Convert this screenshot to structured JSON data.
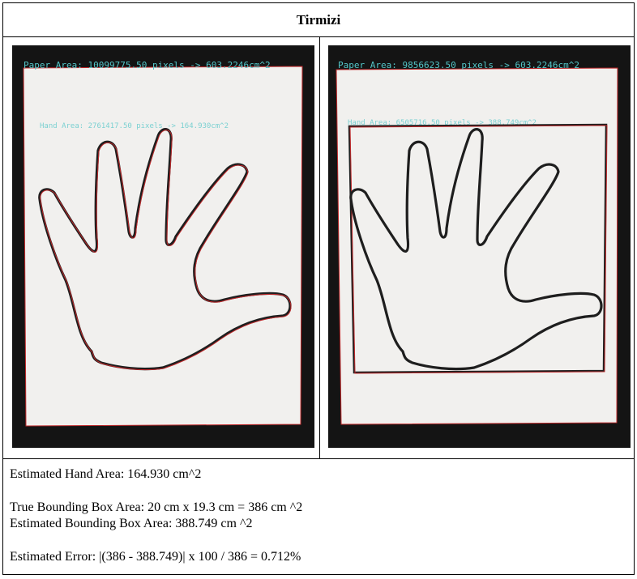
{
  "header": {
    "title": "Tirmizi"
  },
  "left_image": {
    "paper_area_label": "Paper Area: 10099775.50 pixels -> 603.2246cm^2",
    "hand_area_label": "Hand Area: 2761417.50 pixels -> 164.930cm^2"
  },
  "right_image": {
    "paper_area_label": "Paper Area: 9856623.50 pixels -> 603.2246cm^2",
    "box_area_label": "Hand Area: 6505716.50 pixels -> 388.749cm^2"
  },
  "notes": {
    "estimated_hand_area": "Estimated Hand Area: 164.930 cm^2",
    "true_bbox_area": "True Bounding Box Area: 20 cm x 19.3 cm = 386 cm ^2",
    "estimated_bbox_area": "Estimated Bounding Box Area: 388.749 cm ^2",
    "estimated_error": "Estimated Error: |(386 - 388.749)| x 100 / 386 = 0.712%"
  },
  "colors": {
    "overlay_text": "#53c6c8",
    "contour": "#c0282a",
    "paper": "#f1f0ee",
    "background": "#141414"
  }
}
